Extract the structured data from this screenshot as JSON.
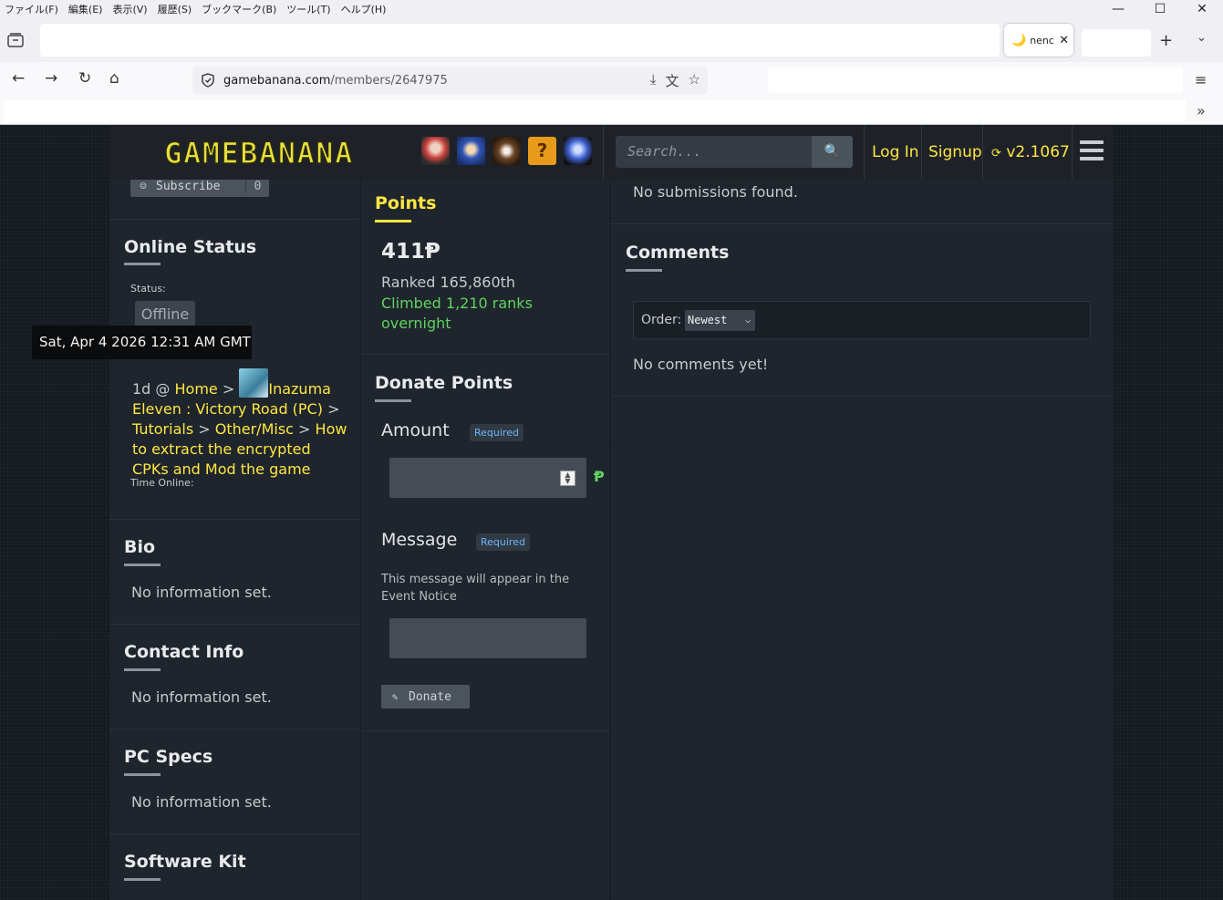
{
  "browser": {
    "menu": [
      "ファイル(F)",
      "編集(E)",
      "表示(V)",
      "履歴(S)",
      "ブックマーク(B)",
      "ツール(T)",
      "ヘルプ(H)"
    ],
    "window_controls": {
      "minimize": "—",
      "maximize": "☐",
      "close": "✕"
    },
    "tab": {
      "favicon": "🌙",
      "title": "nenc",
      "close": "✕"
    },
    "new_tab": "+",
    "tab_list": "⌄",
    "url": {
      "host": "gamebanana.com",
      "path": "/members/2647975"
    },
    "nav": {
      "back": "←",
      "forward": "→",
      "reload": "↻",
      "home": "⌂"
    },
    "url_actions": [
      "⤓",
      "文",
      "☆"
    ],
    "app_menu": "≡",
    "bookmarks_more": "»"
  },
  "header": {
    "logo": "GAMEBANANA",
    "search_placeholder": "Search...",
    "search_icon": "🔍",
    "login": "Log In",
    "signup": "Signup",
    "version_icon": "⟳",
    "version": "v2.1067",
    "game_icons": [
      {
        "name": "friday-night-funkin-icon",
        "color": "#c9423d"
      },
      {
        "name": "sonic-icon",
        "color": "#2f56b5"
      },
      {
        "name": "fnaf-icon",
        "color": "#6b4426"
      },
      {
        "name": "mario-question-block-icon",
        "color": "#e89a1a"
      },
      {
        "name": "megaman-icon",
        "color": "#3d5fcf"
      }
    ]
  },
  "left": {
    "subscribe_label": "Subscribe",
    "subscribe_count": "0",
    "subscribe_icon": "☺",
    "online_status_title": "Online Status",
    "status_label": "Status:",
    "status_value": "Offline",
    "tooltip": "Sat, Apr 4 2026 12:31 AM GMT",
    "location_time": "1d @",
    "location_home": "Home",
    "location_game": "Inazuma Eleven : Victory Road (PC)",
    "location_section": "Tutorials",
    "location_cat": "Other/Misc",
    "location_item": "How to extract the encrypted CPKs and Mod the game",
    "sep": ">",
    "time_online_label": "Time Online:",
    "bio_title": "Bio",
    "bio_value": "No information set.",
    "contact_title": "Contact Info",
    "contact_value": "No information set.",
    "pcspecs_title": "PC Specs",
    "pcspecs_value": "No information set.",
    "software_title": "Software Kit"
  },
  "middle": {
    "points_title": "Points",
    "points_value": "411Ᵽ",
    "ranked": "Ranked 165,860th",
    "climbed": "Climbed 1,210 ranks overnight",
    "donate_title": "Donate Points",
    "amount_label": "Amount",
    "required": "Required",
    "currency": "Ᵽ",
    "message_label": "Message",
    "message_hint": "This message will appear in the Event Notice",
    "donate_button": "Donate",
    "donate_icon": "✎"
  },
  "right": {
    "no_submissions": "No submissions found.",
    "comments_title": "Comments",
    "order_label": "Order:",
    "order_value": "Newest",
    "no_comments": "No comments yet!"
  }
}
